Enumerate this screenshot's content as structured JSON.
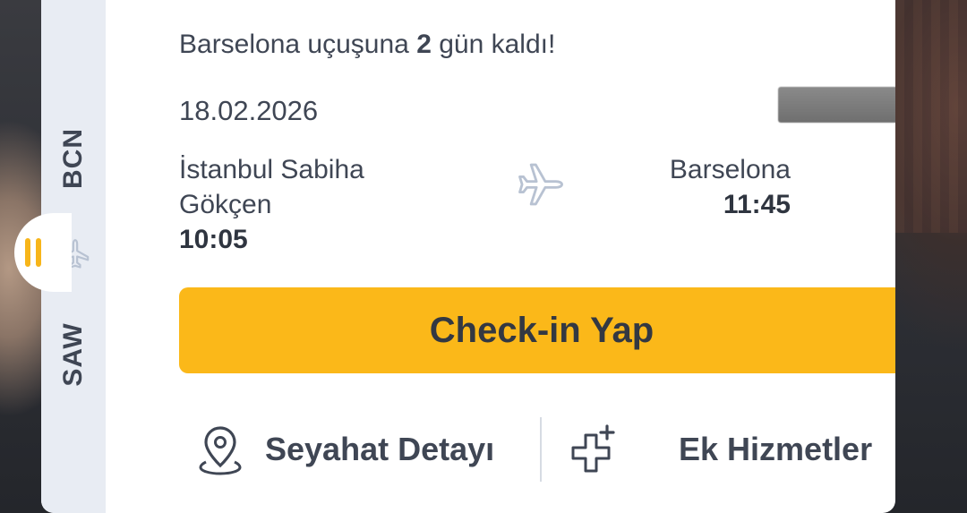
{
  "flight": {
    "origin_code": "SAW",
    "destination_code": "BCN",
    "notice_prefix": "Barselona uçuşuna ",
    "notice_days": "2",
    "notice_suffix": " gün kaldı!",
    "date": "18.02.2026",
    "origin_name": "İstanbul Sabiha Gökçen",
    "departure_time": "10:05",
    "destination_name": "Barselona",
    "arrival_time": "11:45"
  },
  "actions": {
    "checkin_label": "Check-in Yap",
    "trip_detail_label": "Seyahat Detayı",
    "extra_services_label": "Ek Hizmetler"
  },
  "icons": {
    "strip_plane": "airplane-icon",
    "middle_plane": "airplane-icon",
    "trip_detail": "location-pin-icon",
    "extra_services": "plus-add-icon"
  },
  "colors": {
    "accent": "#fbb819",
    "text": "#3f4654",
    "strip": "#e8ecf3"
  }
}
